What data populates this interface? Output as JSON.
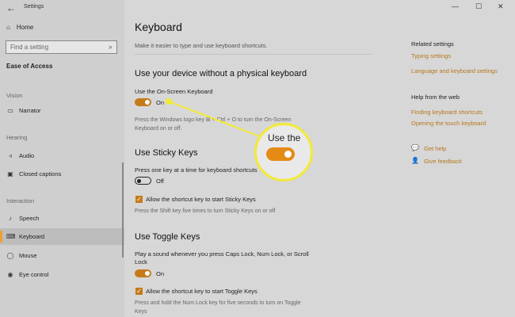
{
  "window": {
    "title": "Settings",
    "minimize": "—",
    "maximize": "☐",
    "close": "✕",
    "back": "←"
  },
  "sidebar": {
    "home_label": "Home",
    "search_placeholder": "Find a setting",
    "section_title": "Ease of Access",
    "groups": [
      {
        "label": "Vision",
        "items": [
          {
            "label": "Narrator",
            "icon": "narrator-icon"
          }
        ]
      },
      {
        "label": "Hearing",
        "items": [
          {
            "label": "Audio",
            "icon": "speaker-icon"
          },
          {
            "label": "Closed captions",
            "icon": "captions-icon"
          }
        ]
      },
      {
        "label": "Interaction",
        "items": [
          {
            "label": "Speech",
            "icon": "microphone-icon"
          },
          {
            "label": "Keyboard",
            "icon": "keyboard-icon",
            "active": true
          },
          {
            "label": "Mouse",
            "icon": "mouse-icon"
          },
          {
            "label": "Eye control",
            "icon": "eye-icon"
          }
        ]
      }
    ]
  },
  "main": {
    "title": "Keyboard",
    "subtitle": "Make it easier to type and use keyboard shortcuts.",
    "sections": [
      {
        "heading": "Use your device without a physical keyboard",
        "setting_label": "Use the On-Screen Keyboard",
        "toggle_state": "On",
        "help_line1": "Press the Windows logo key ⊞ + Ctrl + O to turn the On-Screen",
        "help_line2": "Keyboard on or off."
      },
      {
        "heading": "Use Sticky Keys",
        "setting_label": "Press one key at a time for keyboard shortcuts",
        "toggle_state": "Off",
        "checkbox_label": "Allow the shortcut key to start Sticky Keys",
        "checkbox_help": "Press the Shift key five times to turn Sticky Keys on or off"
      },
      {
        "heading": "Use Toggle Keys",
        "setting_line1": "Play a sound whenever you press Caps Lock, Num Lock, or Scroll",
        "setting_line2": "Lock",
        "toggle_state": "On",
        "checkbox_label": "Allow the shortcut key to start Toggle Keys",
        "checkbox_help_line1": "Press and hold the Num Lock key for five seconds to turn on Toggle",
        "checkbox_help_line2": "Keys"
      }
    ]
  },
  "right": {
    "related_heading": "Related settings",
    "related_links": [
      "Typing settings",
      "Language and keyboard settings"
    ],
    "web_heading": "Help from the web",
    "web_links": [
      "Finding keyboard shortcuts",
      "Opening the touch keyboard"
    ],
    "get_help": "Get help",
    "give_feedback": "Give feedback"
  },
  "callout": {
    "text": "Use the",
    "highlight_color": "#f3ea35"
  },
  "colors": {
    "accent": "#c57a19",
    "link": "#b8771c"
  }
}
